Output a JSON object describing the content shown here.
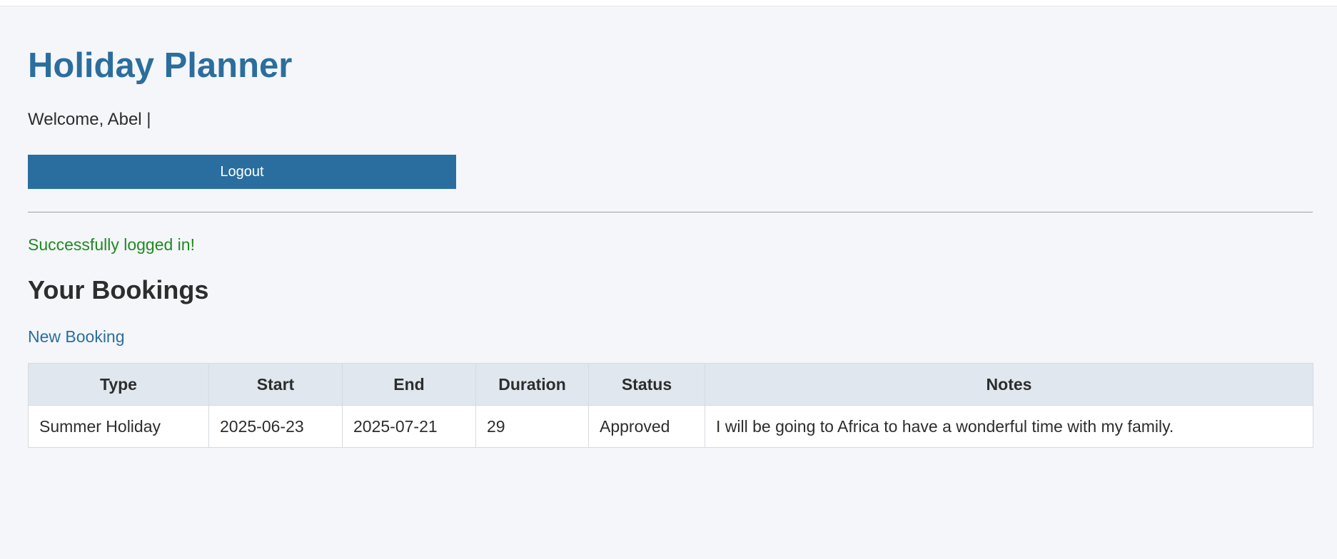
{
  "app": {
    "title": "Holiday Planner"
  },
  "header": {
    "welcome_text": "Welcome, Abel |",
    "logout_label": "Logout"
  },
  "flash": {
    "message": "Successfully logged in!",
    "color": "#1f8a1f"
  },
  "bookings": {
    "title": "Your Bookings",
    "new_booking_label": "New Booking",
    "columns": [
      "Type",
      "Start",
      "End",
      "Duration",
      "Status",
      "Notes"
    ],
    "rows": [
      {
        "type": "Summer Holiday",
        "start": "2025-06-23",
        "end": "2025-07-21",
        "duration": "29",
        "status": "Approved",
        "notes": "I will be going to Africa to have a wonderful time with my family."
      }
    ]
  },
  "colors": {
    "accent": "#2a6e9f",
    "background": "#f4f6fa",
    "table_header": "#e0e7ee"
  }
}
